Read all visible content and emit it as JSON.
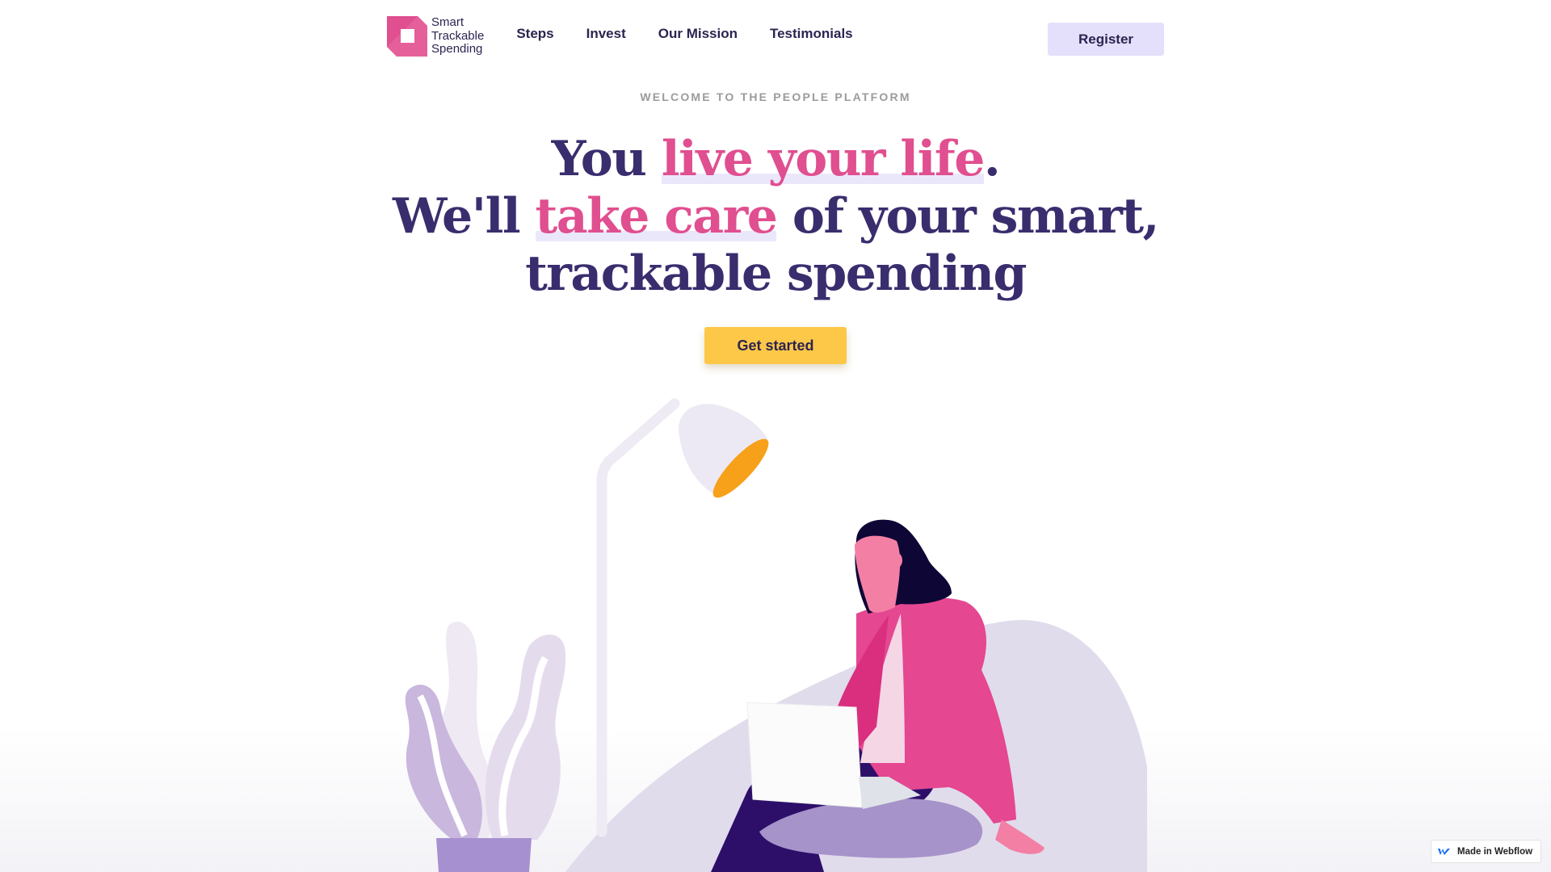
{
  "brand": {
    "name_lines": [
      "Smart",
      "Trackable",
      "Spending"
    ],
    "colors": {
      "primary": "#3a2d6e",
      "accent": "#e04f8f",
      "cta": "#fdc848",
      "register_bg": "#e4e0fb"
    }
  },
  "nav": {
    "links": [
      "Steps",
      "Invest",
      "Our Mission",
      "Testimonials"
    ],
    "register_label": "Register"
  },
  "hero": {
    "eyebrow": "WELCOME TO THE PEOPLE PLATFORM",
    "line1": {
      "pre": "You ",
      "highlight": "live your life",
      "post": "."
    },
    "line2": {
      "pre": "We'll ",
      "highlight": "take care",
      "post": " of your smart,"
    },
    "line3": "trackable spending",
    "cta_label": "Get started",
    "illustration": "woman-sitting-in-beanbag-with-laptop-under-lamp-next-to-plant"
  },
  "badge": {
    "label": "Made in Webflow",
    "icon": "webflow-logo-icon"
  }
}
